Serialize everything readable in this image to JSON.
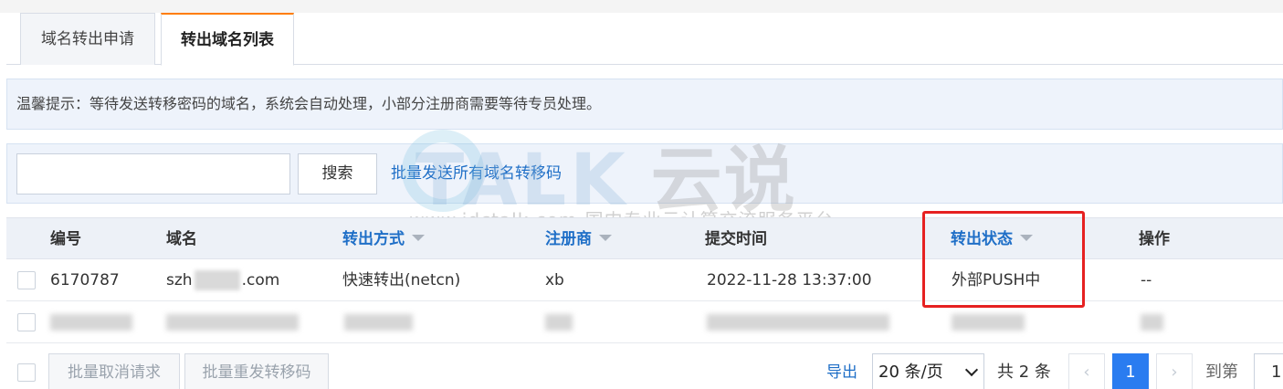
{
  "tabs": [
    {
      "label": "域名转出申请",
      "active": false
    },
    {
      "label": "转出域名列表",
      "active": true
    }
  ],
  "tip": "温馨提示：等待发送转移密码的域名，系统会自动处理，小部分注册商需要等待专员处理。",
  "search": {
    "value": "",
    "button_label": "搜索",
    "bulk_send_link": "批量发送所有域名转移码"
  },
  "watermark": {
    "brand": "TALK",
    "brand_cn": "云说",
    "sub": "-www.idctalk.com-国内专业云计算交流服务平台-"
  },
  "table": {
    "columns": [
      {
        "label": "编号",
        "sortable": false
      },
      {
        "label": "域名",
        "sortable": false
      },
      {
        "label": "转出方式",
        "sortable": true
      },
      {
        "label": "注册商",
        "sortable": true
      },
      {
        "label": "提交时间",
        "sortable": false
      },
      {
        "label": "转出状态",
        "sortable": true
      },
      {
        "label": "操作",
        "sortable": false
      }
    ],
    "rows": [
      {
        "id": "6170787",
        "domain_prefix": "szh",
        "domain_suffix": ".com",
        "method": "快速转出(netcn)",
        "registrar": "xb",
        "submitted": "2022-11-28 13:37:00",
        "status": "外部PUSH中",
        "action": "--"
      }
    ]
  },
  "footer": {
    "bulk_cancel": "批量取消请求",
    "bulk_resend": "批量重发转移码",
    "export": "导出",
    "page_size": "20 条/页",
    "total": "共 2 条",
    "prev": "‹",
    "current_page": "1",
    "next": "›",
    "goto_label": "到第",
    "goto_value": "1"
  },
  "colors": {
    "accent": "#1f6fc7",
    "active_tab": "#ff7d00",
    "highlight": "#e62121",
    "page_current": "#2a7cf0"
  }
}
